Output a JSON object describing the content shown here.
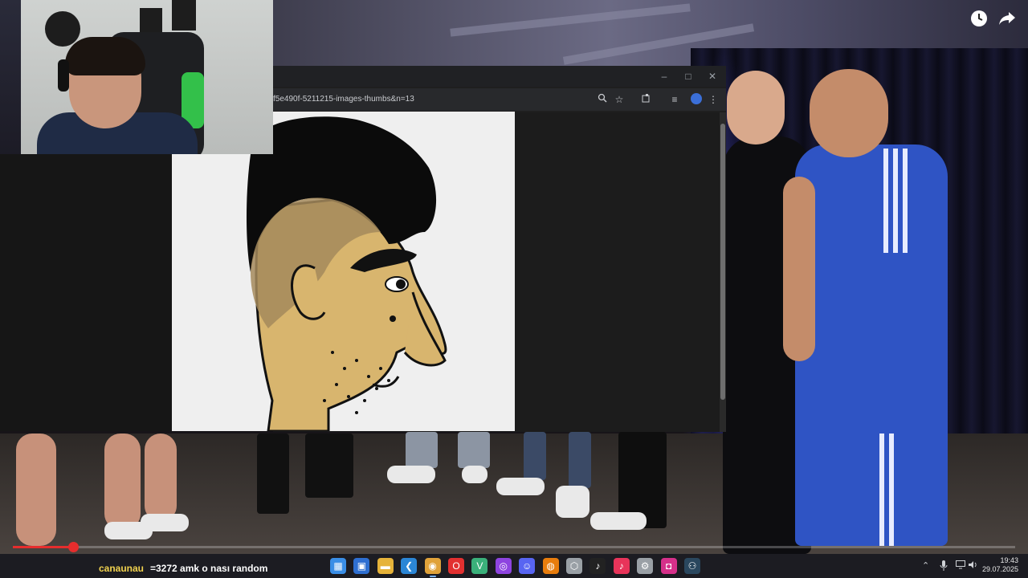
{
  "video": {
    "watermark": "",
    "icons": [
      "clock-icon",
      "share-icon"
    ]
  },
  "browser": {
    "url": "f5e490f-5211215-images-thumbs&n=13",
    "window_controls": [
      "minimize",
      "maximize",
      "close"
    ],
    "toolbar_icons": [
      "zoom-icon",
      "bookmark-star-icon",
      "extensions-icon",
      "media-control-icon",
      "profile-avatar-icon",
      "more-menu-icon"
    ]
  },
  "stream": {
    "progress_fraction": 0.06
  },
  "chat": {
    "username": "canaunau",
    "message": "=3272 amk o nası random"
  },
  "taskbar": {
    "apps": [
      {
        "name": "windows-start",
        "color": "#3a8ee6",
        "glyph": "▦"
      },
      {
        "name": "microsoft-store",
        "color": "#2e6fd1",
        "glyph": "▣"
      },
      {
        "name": "file-explorer",
        "color": "#e6b33a",
        "glyph": "▬"
      },
      {
        "name": "vscode",
        "color": "#2b86d6",
        "glyph": "❮"
      },
      {
        "name": "chrome",
        "color": "#e0a23a",
        "glyph": "◉"
      },
      {
        "name": "opera",
        "color": "#e23030",
        "glyph": "O"
      },
      {
        "name": "app-v",
        "color": "#3ab07a",
        "glyph": "V"
      },
      {
        "name": "app-purple",
        "color": "#8e44e0",
        "glyph": "◎"
      },
      {
        "name": "discord",
        "color": "#5865f2",
        "glyph": "☺"
      },
      {
        "name": "blender",
        "color": "#e87d0d",
        "glyph": "◍"
      },
      {
        "name": "app-cube",
        "color": "#9aa0a6",
        "glyph": "⬡"
      },
      {
        "name": "tiktok",
        "color": "#222222",
        "glyph": "♪"
      },
      {
        "name": "tiktok-live",
        "color": "#e8345a",
        "glyph": "♪"
      },
      {
        "name": "app-gear",
        "color": "#9aa0a6",
        "glyph": "⚙"
      },
      {
        "name": "instagram",
        "color": "#d6308a",
        "glyph": "◘"
      },
      {
        "name": "steam",
        "color": "#2a475e",
        "glyph": "⚇"
      }
    ],
    "tray_icons": [
      "chevron-up-icon",
      "mic-icon",
      "display-icon",
      "volume-icon"
    ],
    "time": "19:43",
    "date": "29.07.2025"
  }
}
